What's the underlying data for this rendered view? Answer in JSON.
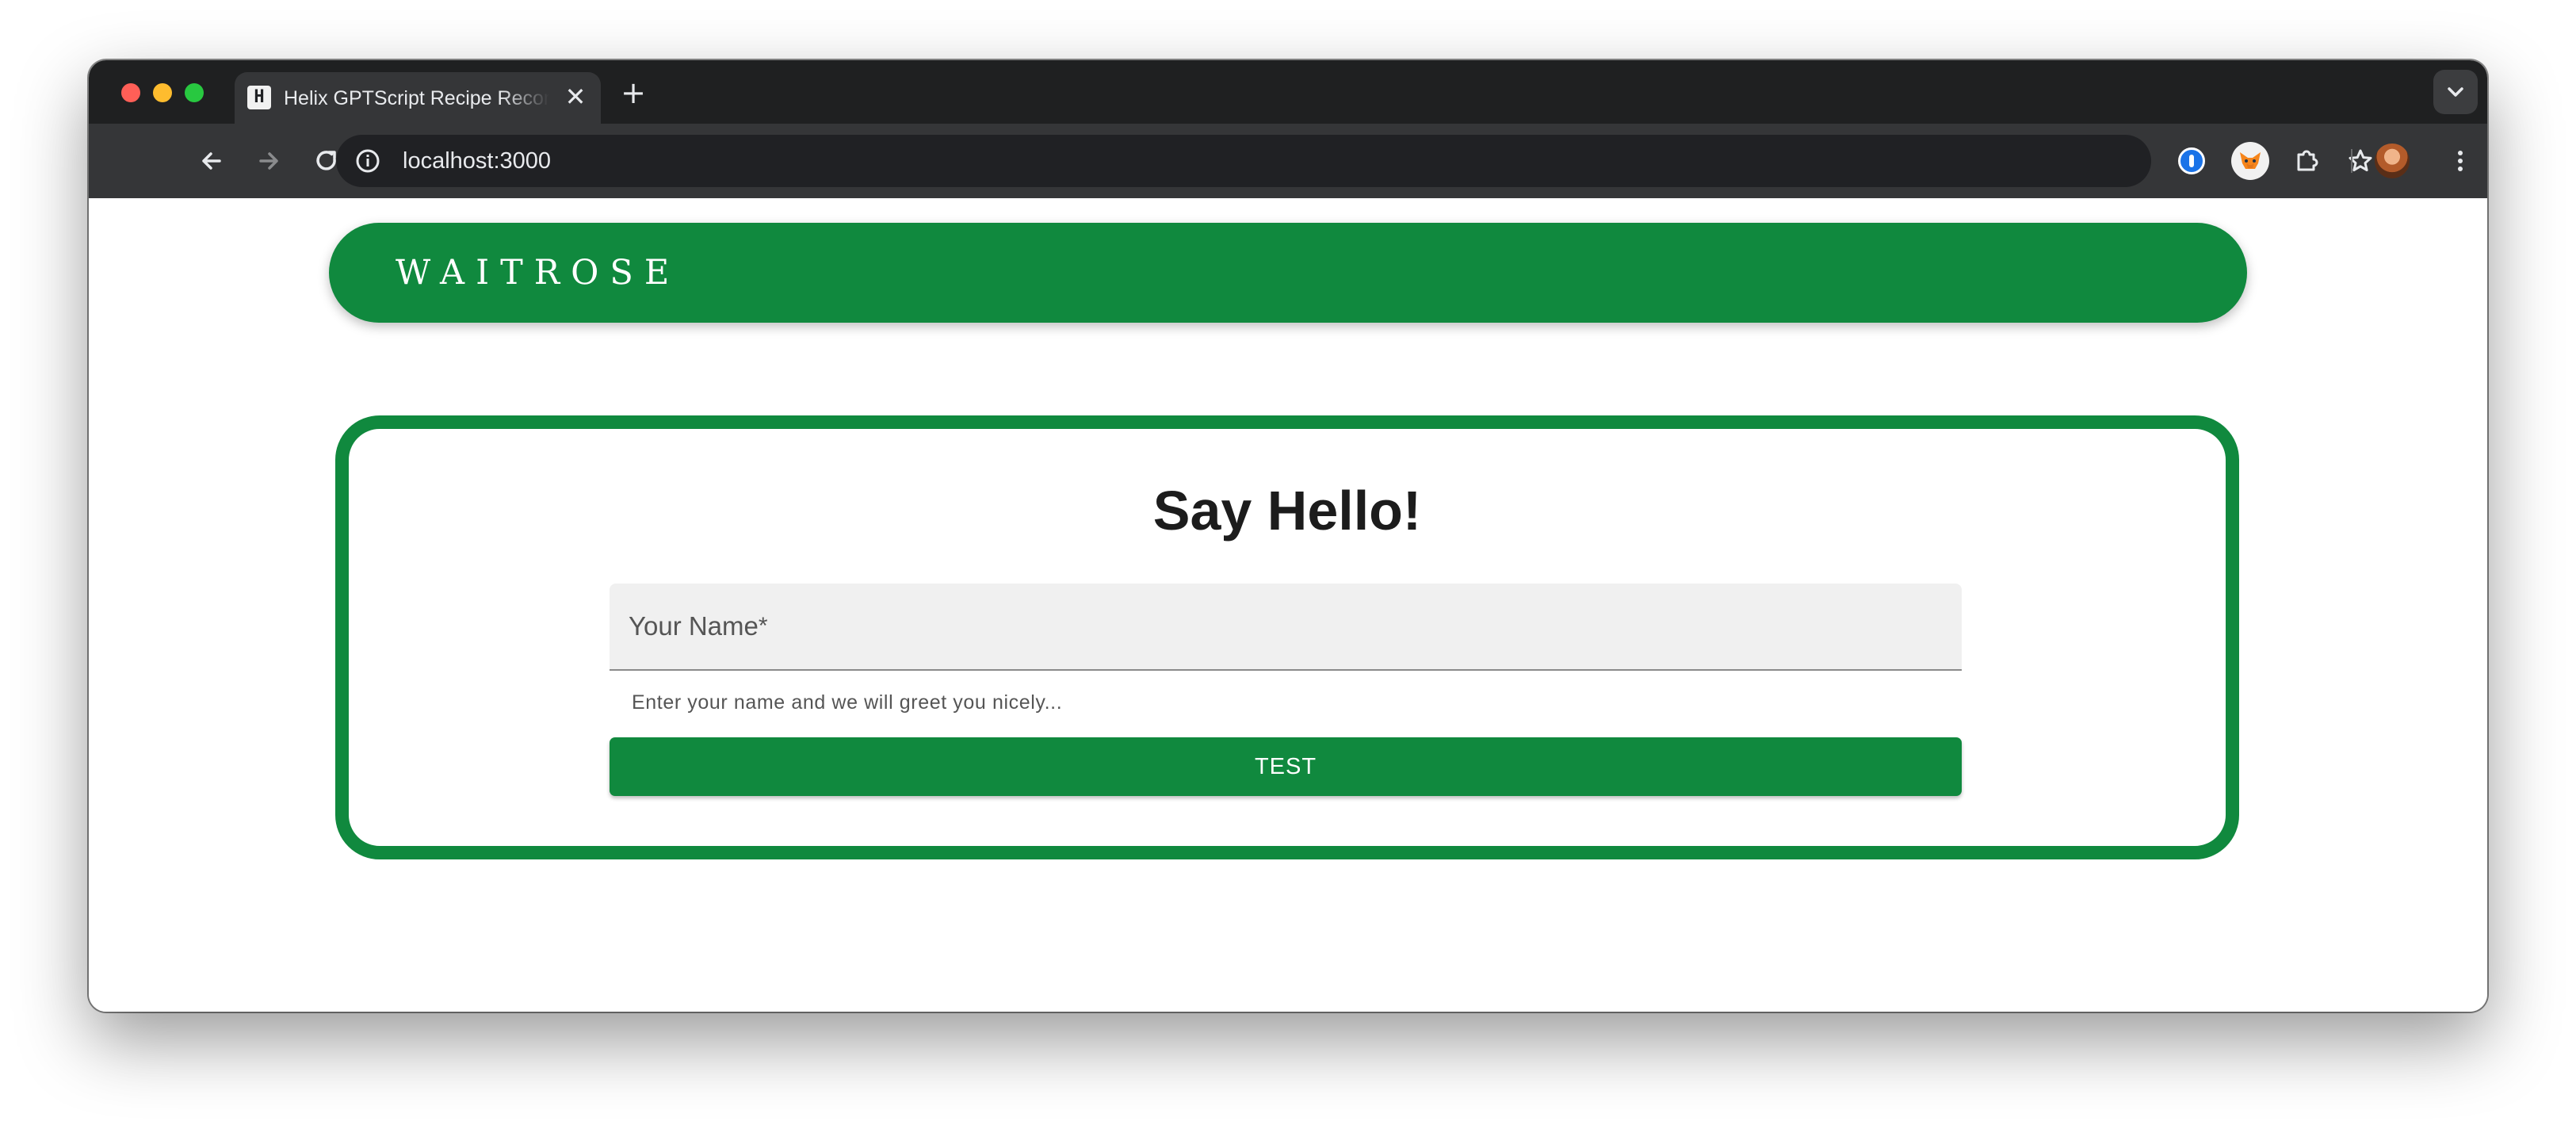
{
  "browser": {
    "tab": {
      "favicon_text": "H",
      "title": "Helix GPTScript Recipe Recommender",
      "close_glyph": "✕"
    },
    "new_tab_glyph": "+",
    "address": {
      "url": "localhost:3000"
    },
    "icons": [
      "back-icon",
      "forward-icon",
      "reload-icon",
      "home-icon",
      "site-info-icon",
      "bookmark-star-icon",
      "password-manager-icon",
      "metamask-fox-icon",
      "extensions-puzzle-icon",
      "profile-avatar",
      "more-menu-icon",
      "tab-search-icon"
    ]
  },
  "page": {
    "header": {
      "brand": "WAITROSE",
      "color": "#10893e"
    },
    "card": {
      "title": "Say Hello!",
      "input": {
        "label": "Your Name",
        "required_marker": "*",
        "value": "",
        "helper_text": "Enter your name and we will greet you nicely..."
      },
      "button_label": "TEST"
    }
  }
}
